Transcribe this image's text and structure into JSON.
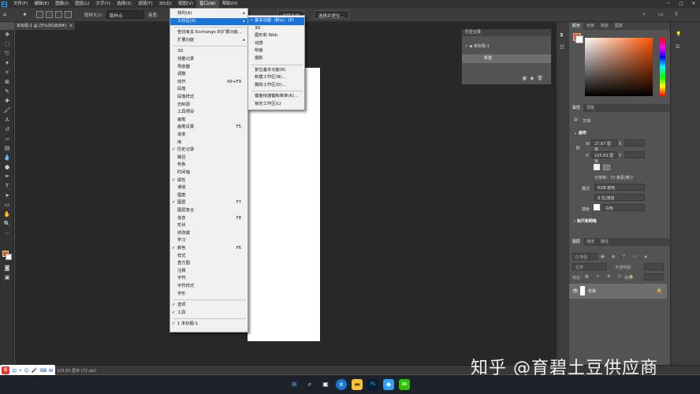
{
  "menubar": {
    "logo": "Ps",
    "items": [
      "文件(F)",
      "编辑(E)",
      "图像(I)",
      "图层(L)",
      "文字(Y)",
      "选择(S)",
      "滤镜(T)",
      "3D(D)",
      "视图(V)",
      "窗口(W)",
      "帮助(H)"
    ],
    "active_index": 9
  },
  "options": {
    "sample_size_label": "取样大小:",
    "sample_size_value": "取样点",
    "tolerance_label": "容差:",
    "subject_button": "选择主体",
    "select_mask_button": "选择并遮住..."
  },
  "document_tab": {
    "title": "未标题-1 @ 25%(RGB/8#)",
    "close": "×"
  },
  "window_menu": {
    "items": [
      {
        "label": "排列(A)",
        "arrow": true
      },
      {
        "label": "工作区(K)",
        "arrow": true,
        "highlight": true
      },
      {
        "sep": true
      },
      {
        "label": "查找有关 Exchange 的扩展功能..."
      },
      {
        "label": "扩展功能",
        "arrow": true
      },
      {
        "sep": true
      },
      {
        "label": "3D"
      },
      {
        "label": "测量记录"
      },
      {
        "label": "导航器"
      },
      {
        "label": "调整"
      },
      {
        "label": "动作",
        "shortcut": "Alt+F9"
      },
      {
        "label": "段落"
      },
      {
        "label": "段落样式"
      },
      {
        "label": "仿制源"
      },
      {
        "label": "工具预设"
      },
      {
        "label": "画笔"
      },
      {
        "label": "画笔设置",
        "shortcut": "F5"
      },
      {
        "label": "渐变"
      },
      {
        "label": "库"
      },
      {
        "label": "历史记录",
        "check": true
      },
      {
        "label": "路径"
      },
      {
        "label": "色板"
      },
      {
        "label": "时间轴"
      },
      {
        "label": "属性",
        "check": true
      },
      {
        "label": "通道"
      },
      {
        "label": "图案"
      },
      {
        "label": "图层",
        "shortcut": "F7",
        "check": true
      },
      {
        "label": "图层复合"
      },
      {
        "label": "信息",
        "shortcut": "F8"
      },
      {
        "label": "形状"
      },
      {
        "label": "修改键"
      },
      {
        "label": "学习"
      },
      {
        "label": "颜色",
        "shortcut": "F6",
        "check": true
      },
      {
        "label": "样式"
      },
      {
        "label": "直方图"
      },
      {
        "label": "注释"
      },
      {
        "label": "字符"
      },
      {
        "label": "字符样式"
      },
      {
        "label": "字形"
      },
      {
        "sep": true
      },
      {
        "label": "选项",
        "check": true
      },
      {
        "label": "工具",
        "check": true
      },
      {
        "sep": true
      },
      {
        "label": "1 未标题-1",
        "check": true
      }
    ]
  },
  "workspace_submenu": {
    "items": [
      {
        "label": "基本功能（默认）(E)",
        "check": true,
        "highlight": true
      },
      {
        "label": "3D"
      },
      {
        "label": "图形和 Web"
      },
      {
        "label": "动感"
      },
      {
        "label": "绘画"
      },
      {
        "label": "摄影"
      },
      {
        "sep": true
      },
      {
        "label": "复位基本功能(R)"
      },
      {
        "label": "新建工作区(N)..."
      },
      {
        "label": "删除工作区(D)..."
      },
      {
        "sep": true
      },
      {
        "label": "键盘快捷键和菜单(K)..."
      },
      {
        "label": "锁定工作区(L)"
      }
    ]
  },
  "history_panel": {
    "title": "历史记录",
    "snapshot": "未标题-1",
    "step": "新建"
  },
  "color_panel": {
    "tabs": [
      "颜色",
      "色板",
      "渐变",
      "图案"
    ],
    "foreground": "#e85c1a",
    "background": "#ffffff"
  },
  "properties_panel": {
    "tabs": [
      "属性",
      "调整"
    ],
    "type_label": "文档",
    "section_canvas": "画布",
    "w_label": "W",
    "w_value": "27.87 厘米",
    "x_label": "X",
    "h_label": "H",
    "h_value": "105.83 厘米",
    "y_label": "Y",
    "resolution": "分辨率：72 像素/英寸",
    "mode_label": "模式",
    "mode_value": "RGB 颜色",
    "depth_value": "8 位/通道",
    "fill_label": "填色",
    "fill_value": "白色",
    "section_rulers": "标尺和网格"
  },
  "layers_panel": {
    "tabs": [
      "图层",
      "通道",
      "路径"
    ],
    "filter_placeholder": "Q 类型",
    "blend_mode": "正常",
    "opacity_label": "不透明度：",
    "lock_label": "锁定：",
    "fill_label": "填充：",
    "layer_name": "背景"
  },
  "status": {
    "size": "105.83 厘米 (72 ppi)"
  },
  "ime": {
    "logo": "S",
    "items": [
      "中",
      "•",
      "☺",
      "🎤",
      "⌨",
      "⊞"
    ]
  },
  "watermark": "知乎 @育碧土豆供应商"
}
